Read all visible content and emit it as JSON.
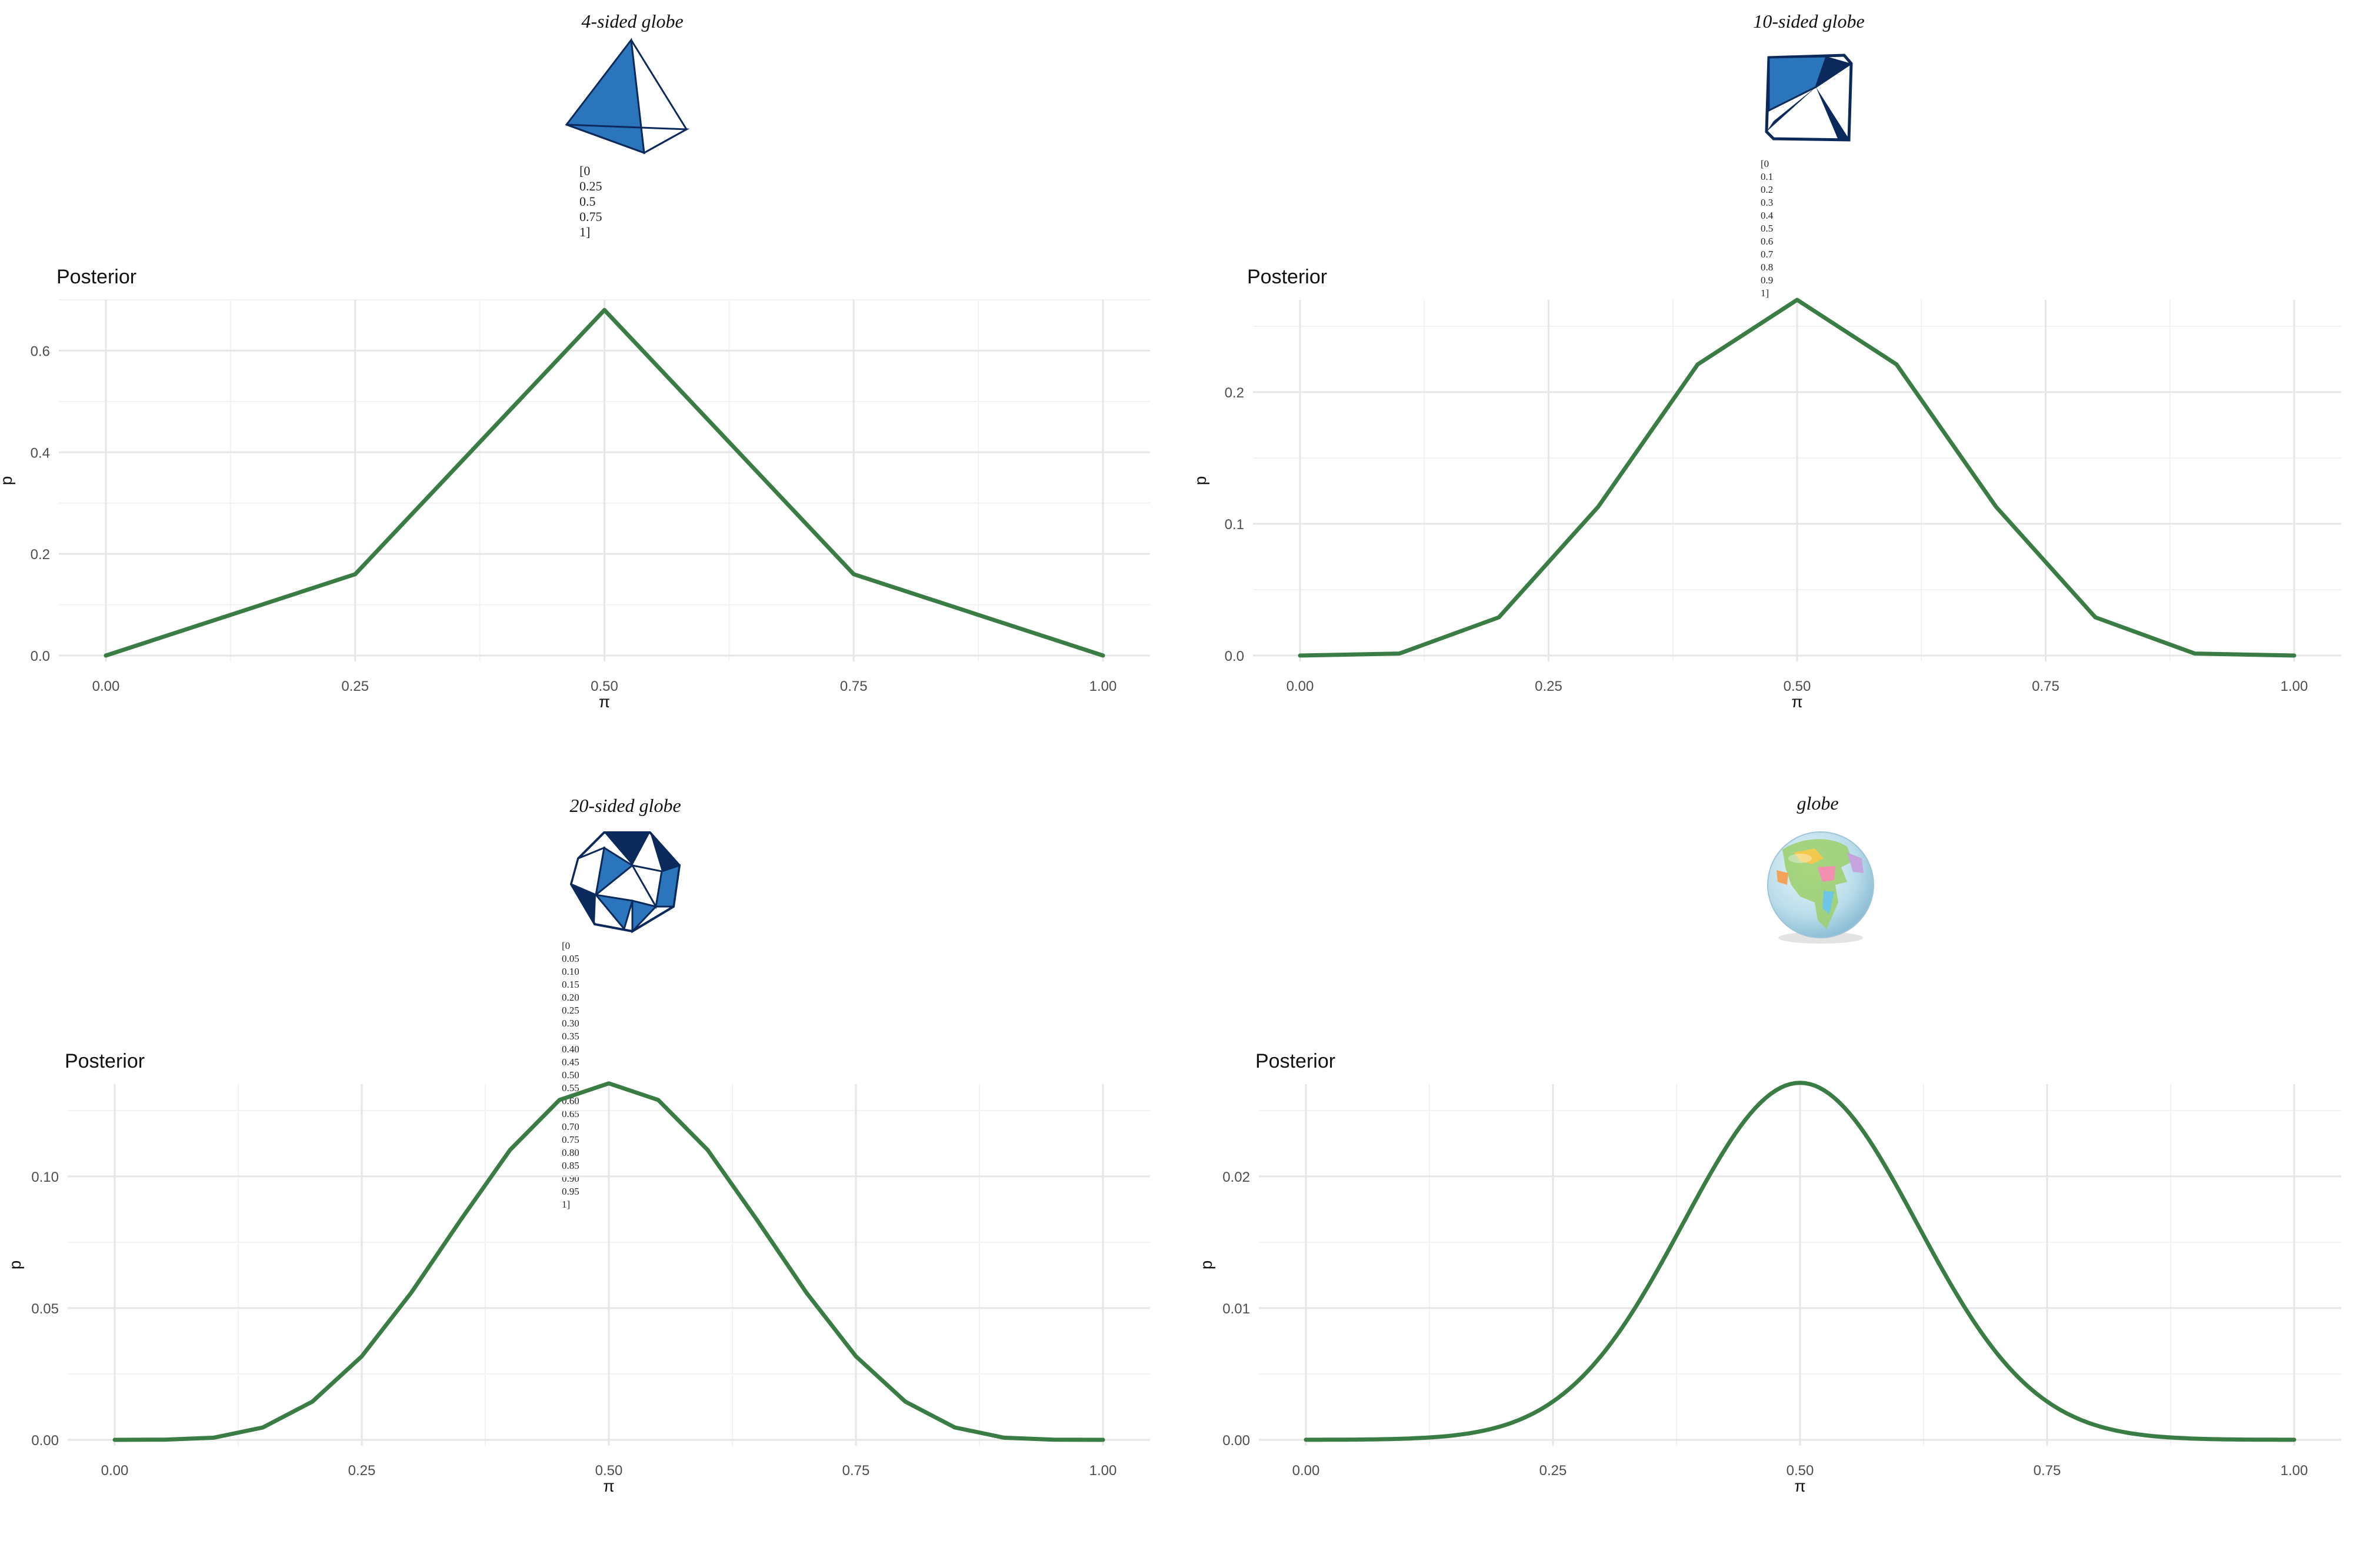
{
  "colors": {
    "line": "#3a7d44",
    "grid_major": "#e6e6e6",
    "grid_minor": "#f2f2f2",
    "tick_text": "#4d4d4d",
    "globe_fill": "#2a75bb",
    "globe_dark": "#0b2a5b"
  },
  "globes": [
    {
      "caption": "4-sided globe",
      "values_lines": [
        "[0 0.25 0.5 0.75 1]"
      ],
      "icon": "tetrahedron-icon"
    },
    {
      "caption": "10-sided globe",
      "values_lines": [
        "[0 0.1 0.2 0.3 0.4 0.5",
        "0.6 0.7 0.8 0.9 1]"
      ],
      "icon": "decahedron-icon"
    },
    {
      "caption": "20-sided globe",
      "values_lines": [
        "[0 0.05 0.10 0.15 0.20 0.25 0.30",
        "0.35 0.40 0.45 0.50 0.55 0.60 0.65",
        "0.70 0.75 0.80 0.85 0.90 0.95 1]"
      ],
      "icon": "icosahedron-icon"
    },
    {
      "caption": "globe",
      "values_lines": [],
      "icon": "earth-globe-icon"
    }
  ],
  "chart_data": [
    {
      "type": "line",
      "title": "Posterior",
      "xlabel": "π",
      "ylabel": "p",
      "xlim": [
        0,
        1
      ],
      "ylim": [
        0,
        0.7
      ],
      "x_ticks": [
        "0.00",
        "0.25",
        "0.50",
        "0.75",
        "1.00"
      ],
      "y_ticks": [
        "0.0",
        "0.2",
        "0.4",
        "0.6"
      ],
      "grid": true,
      "x": [
        0,
        0.25,
        0.5,
        0.75,
        1
      ],
      "y": [
        0,
        0.16,
        0.68,
        0.16,
        0
      ]
    },
    {
      "type": "line",
      "title": "Posterior",
      "xlabel": "π",
      "ylabel": "p",
      "xlim": [
        0,
        1
      ],
      "ylim": [
        0,
        0.27
      ],
      "x_ticks": [
        "0.00",
        "0.25",
        "0.50",
        "0.75",
        "1.00"
      ],
      "y_ticks": [
        "0.0",
        "0.1",
        "0.2"
      ],
      "grid": true,
      "x": [
        0,
        0.1,
        0.2,
        0.3,
        0.4,
        0.5,
        0.6,
        0.7,
        0.8,
        0.9,
        1
      ],
      "y": [
        0,
        0.0015,
        0.029,
        0.113,
        0.221,
        0.27,
        0.221,
        0.113,
        0.029,
        0.0015,
        0
      ]
    },
    {
      "type": "line",
      "title": "Posterior",
      "xlabel": "π",
      "ylabel": "p",
      "xlim": [
        0,
        1
      ],
      "ylim": [
        0,
        0.135
      ],
      "x_ticks": [
        "0.00",
        "0.25",
        "0.50",
        "0.75",
        "1.00"
      ],
      "y_ticks": [
        "0.00",
        "0.05",
        "0.10"
      ],
      "grid": true,
      "x": [
        0,
        0.05,
        0.1,
        0.15,
        0.2,
        0.25,
        0.3,
        0.35,
        0.4,
        0.45,
        0.5,
        0.55,
        0.6,
        0.65,
        0.7,
        0.75,
        0.8,
        0.85,
        0.9,
        0.95,
        1
      ],
      "y": [
        0,
        7e-05,
        0.0008,
        0.0047,
        0.0145,
        0.0317,
        0.0558,
        0.0834,
        0.11,
        0.129,
        0.1353,
        0.129,
        0.11,
        0.0834,
        0.0558,
        0.0317,
        0.0145,
        0.0047,
        0.0008,
        7e-05,
        0
      ]
    },
    {
      "type": "line",
      "title": "Posterior",
      "xlabel": "π",
      "ylabel": "p",
      "xlim": [
        0,
        1
      ],
      "ylim": [
        0,
        0.027
      ],
      "x_ticks": [
        "0.00",
        "0.25",
        "0.50",
        "0.75",
        "1.00"
      ],
      "y_ticks": [
        "0.00",
        "0.01",
        "0.02"
      ],
      "grid": true,
      "x": [
        0,
        0.05,
        0.1,
        0.15,
        0.2,
        0.25,
        0.3,
        0.35,
        0.4,
        0.45,
        0.5,
        0.55,
        0.6,
        0.65,
        0.7,
        0.75,
        0.8,
        0.85,
        0.9,
        0.95,
        1
      ],
      "y": [
        0,
        1.4e-05,
        0.00016,
        0.00094,
        0.0029,
        0.0063,
        0.0112,
        0.0167,
        0.022,
        0.0258,
        0.0271,
        0.0258,
        0.022,
        0.0167,
        0.0112,
        0.0063,
        0.0029,
        0.00094,
        0.00016,
        1.4e-05,
        0
      ]
    }
  ]
}
